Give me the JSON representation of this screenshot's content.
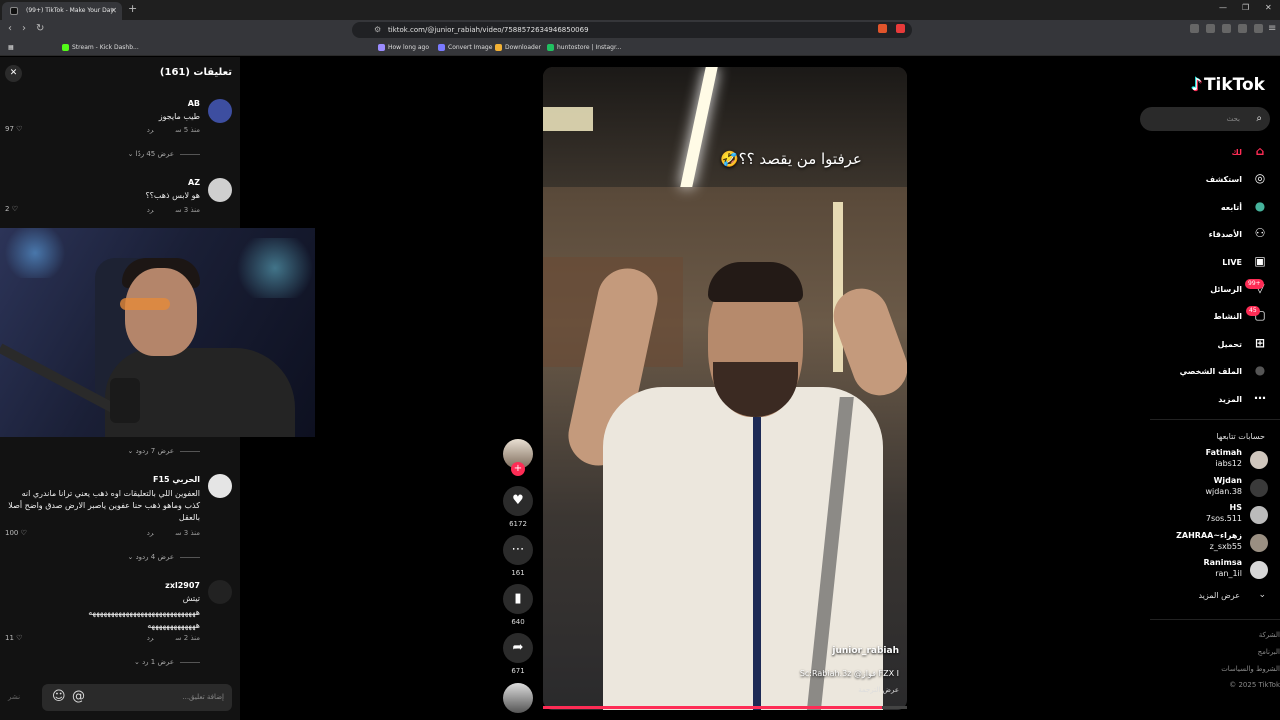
{
  "browser": {
    "tab_title": "(99+) TikTok - Make Your Day",
    "url": "tiktok.com/@junior_rabiah/video/7588572634946850069",
    "bookmarks": [
      {
        "label": "Stream - Kick Dashb...",
        "color": "#53fc18"
      },
      {
        "label": "How long ago",
        "color": "#9b8cff"
      },
      {
        "label": "Convert Image",
        "color": "#7a7aff"
      },
      {
        "label": "Downloader",
        "color": "#f2b134"
      },
      {
        "label": "huntostore | Instagr...",
        "color": "#20c060"
      }
    ]
  },
  "comments": {
    "title": "تعليقات (161)",
    "input_placeholder": "إضافة تعليق...",
    "post_label": "نشر",
    "items": [
      {
        "name": "AB",
        "text": "طيب مايجوز",
        "time": "منذ 5 س",
        "reply": "رد",
        "likes": "97",
        "replies": "عرض 45 ردًا",
        "avatar": "#3d4ea0"
      },
      {
        "name": "AZ",
        "text": "هو لابس ذهب؟؟",
        "time": "منذ 3 س",
        "reply": "رد",
        "likes": "2",
        "replies": "عرض 7 ردود",
        "avatar": "#cfcfcf"
      },
      {
        "name": "الحربي F15",
        "text": "العفوين اللي بالتعليقات اوه ذهب يعني ترانا ماندري انه كذب وماهو ذهب حنا عفوين ياصبر الارض صدق واضح أصلا بالعقل",
        "time": "منذ 3 س",
        "reply": "رد",
        "likes": "100",
        "replies": "عرض 4 ردود",
        "avatar": "#e5e5e5"
      },
      {
        "name": "zxl2907",
        "text": "تيتش",
        "text2": "هههههههههههههههههههههههههههههه",
        "text3": "هههههههههههههه",
        "time": "منذ 2 س",
        "reply": "رد",
        "likes": "11",
        "replies": "عرض 1 رد",
        "avatar": "#222222"
      }
    ]
  },
  "video": {
    "caption_overlay": "عرفتوا من يقصد ؟؟🤣",
    "author": "junior_rabiah",
    "description": "FZX I فواز@ Sc:Rabiah.3z",
    "translate": "عرض الترجمة",
    "progress": 0.93
  },
  "actions": {
    "likes": "6172",
    "comments": "161",
    "saves": "640",
    "shares": "671"
  },
  "sidebar": {
    "logo": "TikTok",
    "search_placeholder": "بحث",
    "nav": [
      {
        "label": "لك",
        "icon": "home-icon",
        "glyph": "⌂"
      },
      {
        "label": "استكشف",
        "icon": "compass-icon",
        "glyph": "◎"
      },
      {
        "label": "أتابعه",
        "icon": "following-avatar-icon",
        "glyph": "●"
      },
      {
        "label": "الأصدقاء",
        "icon": "friends-icon",
        "glyph": "⚇"
      },
      {
        "label": "LIVE",
        "icon": "live-icon",
        "glyph": "▣"
      },
      {
        "label": "الرسائل",
        "icon": "messages-icon",
        "glyph": "▽"
      },
      {
        "label": "النشاط",
        "icon": "activity-icon",
        "glyph": "▢"
      },
      {
        "label": "تحميل",
        "icon": "upload-icon",
        "glyph": "⊞"
      },
      {
        "label": "الملف الشخصي",
        "icon": "profile-icon",
        "glyph": "●"
      },
      {
        "label": "المزيد",
        "icon": "more-icon",
        "glyph": "⋯"
      }
    ],
    "messages_badge": "99+",
    "activity_badge": "45",
    "following_title": "حسابات تتابعها",
    "following": [
      {
        "name": "Fatimah",
        "handle": "iabs12",
        "avatar": "#cfc6bd"
      },
      {
        "name": "Wjdan",
        "handle": "wjdan.38",
        "avatar": "#3a3a3a"
      },
      {
        "name": "HS",
        "handle": "7sos.511",
        "avatar": "#bbbbbb"
      },
      {
        "name": "ZAHRAA~زهراء",
        "handle": "z_sxb55",
        "avatar": "#9a8f82"
      },
      {
        "name": "Ranimsa",
        "handle": "ran_1il",
        "avatar": "#d7d7d7"
      }
    ],
    "see_more": "عرض المزيد",
    "footer": [
      "الشركة",
      "البرنامج",
      "الشروط والسياسات",
      "© 2025 TikTok"
    ]
  }
}
